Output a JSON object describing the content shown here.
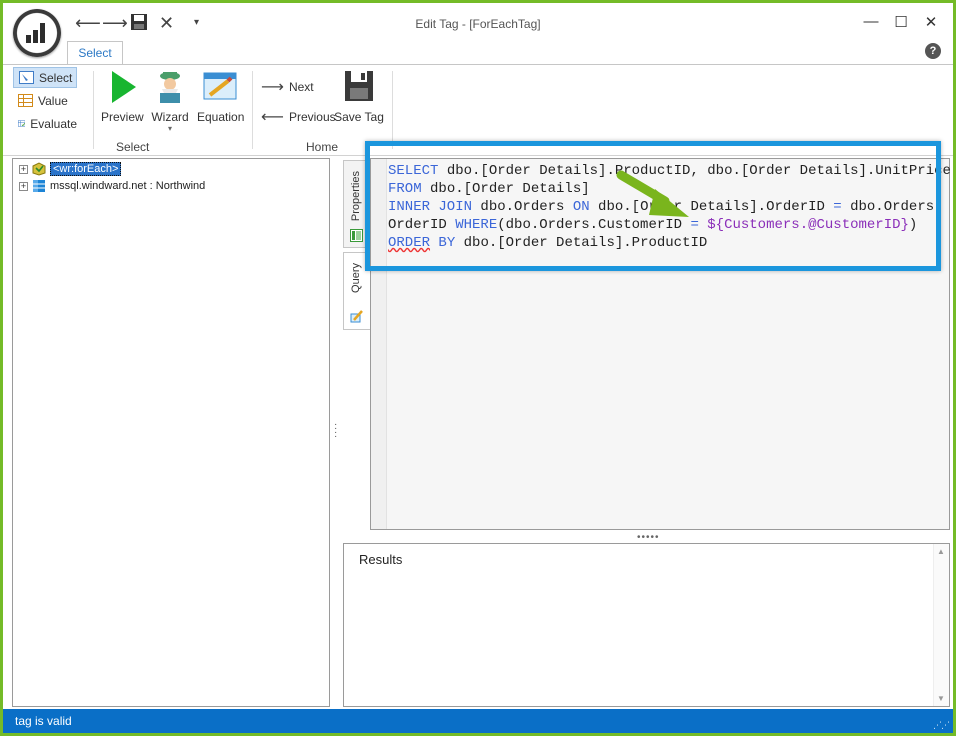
{
  "window": {
    "title": "Edit Tag - [ForEachTag]",
    "minimize": "—",
    "maximize": "☐",
    "close": "✕",
    "help": "?"
  },
  "quick_access": {
    "back": "⟵",
    "forward": "⟶",
    "save": "💾",
    "cancel": "✕",
    "more": "▾"
  },
  "ribbon": {
    "tab": "Select",
    "select_group": {
      "select": "Select",
      "value": "Value",
      "evaluate": "Evaluate",
      "preview": "Preview",
      "wizard": "Wizard",
      "equation": "Equation",
      "label": "Select"
    },
    "home_group": {
      "next": "Next",
      "previous": "Previous",
      "save_tag": "Save Tag",
      "label": "Home"
    }
  },
  "tree": {
    "items": [
      {
        "label": "<wr:forEach>",
        "selected": true
      },
      {
        "label": "mssql.windward.net : Northwind",
        "selected": false
      }
    ]
  },
  "side_tabs": {
    "properties": "Properties",
    "query": "Query"
  },
  "editor": {
    "line1_kw": "SELECT",
    "line1_rest": " dbo.[Order Details].ProductID, dbo.[Order Details].UnitPrice",
    "line2_kw": "FROM",
    "line2_rest": " dbo.[Order Details]",
    "line3_kw1": "INNER JOIN",
    "line3_mid1": " dbo.Orders ",
    "line3_kw2": "ON",
    "line3_mid2": " dbo.[Order Details].OrderID ",
    "line3_eq": "=",
    "line3_end": " dbo.Orders.",
    "line4_start": "OrderID ",
    "line4_kw": "WHERE",
    "line4_mid": "(dbo.Orders.CustomerID ",
    "line4_eq": "=",
    "line4_var": " ${Customers.@CustomerID}",
    "line4_end": ")",
    "line5_kw1": "ORDER",
    "line5_kw2": " BY",
    "line5_rest": " dbo.[Order Details].ProductID"
  },
  "results": {
    "title": "Results"
  },
  "status": {
    "text": "tag is valid"
  },
  "colors": {
    "accent": "#1b96dd",
    "status_bar": "#0a6fc7",
    "frame": "#74bb28",
    "arrow": "#7ab51d"
  }
}
